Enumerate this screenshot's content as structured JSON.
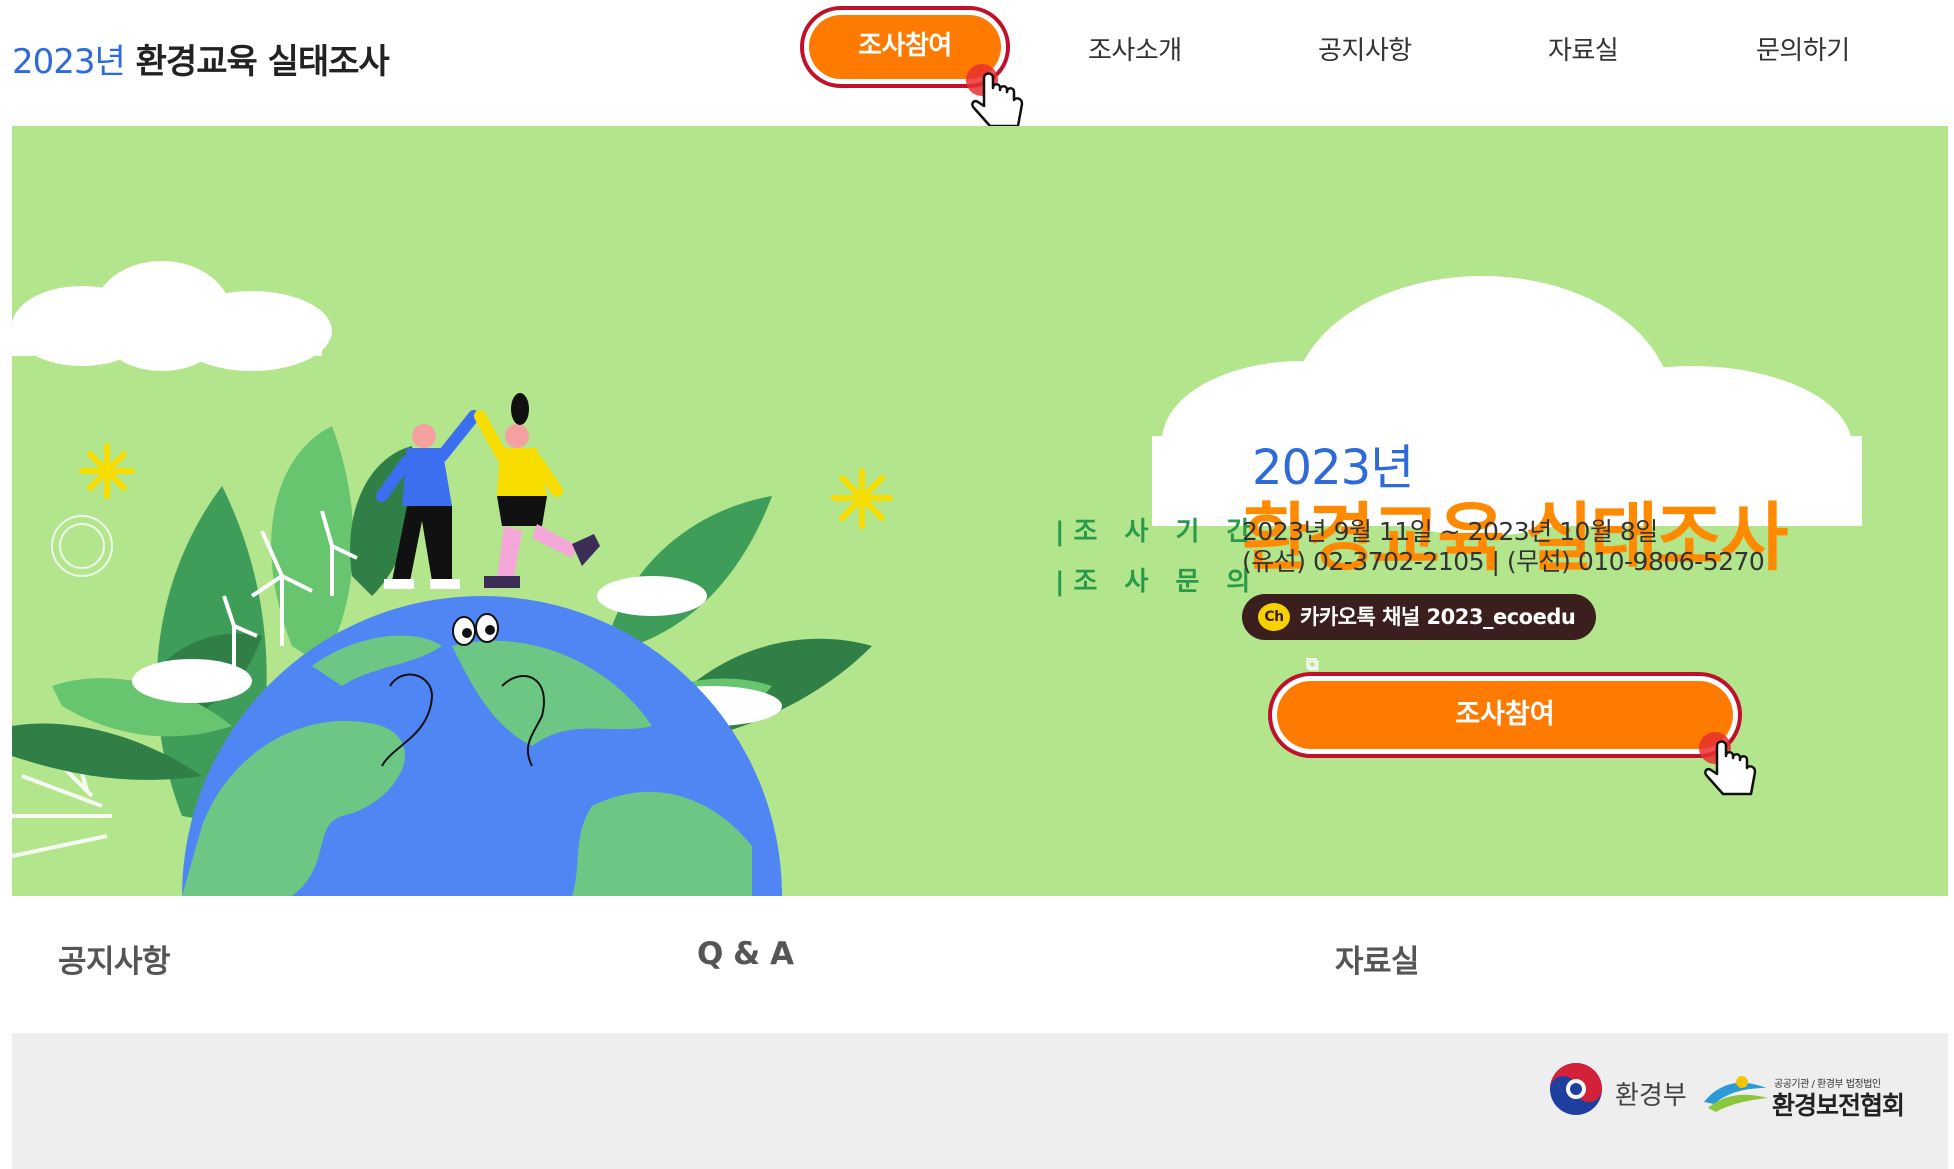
{
  "header": {
    "title_year": "2023년",
    "title_main": "환경교육 실태조사",
    "nav": {
      "primary": "조사참여",
      "items": [
        "조사소개",
        "공지사항",
        "자료실",
        "문의하기"
      ]
    }
  },
  "hero": {
    "title_year": "2023년",
    "title_main": "환경교육 실태조사",
    "period_label": "|조 사 기 간",
    "period_value": "2023년 9월 11일 ~ 2023년 10월 8일",
    "contact_label": "|조 사 문 의",
    "contact_value": "(유선) 02-3702-2105 | (무선) 010-9806-5270",
    "kakao_badge": "Ch",
    "kakao_label": "카카오톡 채널 2023_ecoedu",
    "cta": "조사참여"
  },
  "sections": [
    "공지사항",
    "Q & A",
    "자료실"
  ],
  "footer": {
    "ministry": "환경부",
    "assoc_small": "공공기관 / 환경부 법정법인",
    "assoc": "환경보전협회"
  },
  "icons": [
    "hand-pointer-icon",
    "external-link-icon",
    "kakao-channel-icon",
    "ministry-emblem-icon",
    "association-logo-icon"
  ],
  "colors": {
    "accent": "#ff7a00",
    "highlight_ring": "#c0102a",
    "hero_bg": "#b3e58c",
    "brand_blue": "#2f6bd8",
    "label_green": "#2a9a4a",
    "kakao_bg": "#3b1e1e"
  }
}
